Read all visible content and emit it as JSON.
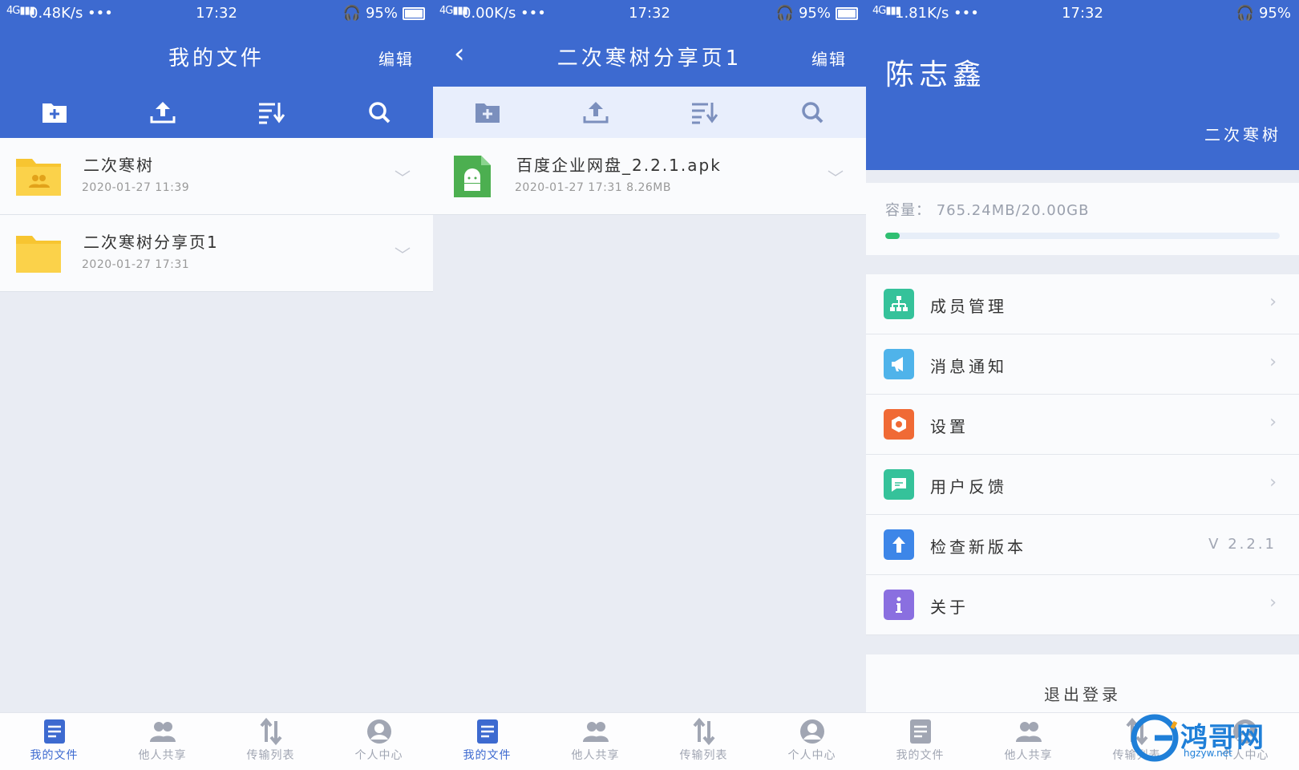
{
  "colors": {
    "primary": "#3d6ad0",
    "folder": "#f7c531",
    "apk": "#4caf50",
    "progress": "#2fbf71"
  },
  "panels": [
    {
      "status": {
        "net": "0.48K/s •••",
        "time": "17:32",
        "battery": "95%"
      },
      "title": "我的文件",
      "edit": "编辑",
      "files": [
        {
          "name": "二次寒树",
          "meta": "2020-01-27   11:39",
          "icon": "shared-folder-icon"
        },
        {
          "name": "二次寒树分享页1",
          "meta": "2020-01-27   17:31",
          "icon": "folder-icon"
        }
      ]
    },
    {
      "status": {
        "net": "0.00K/s •••",
        "time": "17:32",
        "battery": "95%"
      },
      "title": "二次寒树分享页1",
      "edit": "编辑",
      "files": [
        {
          "name": "百度企业网盘_2.2.1.apk",
          "meta": "2020-01-27   17:31   8.26MB",
          "icon": "android-apk-icon"
        }
      ]
    },
    {
      "status": {
        "net": "1.81K/s •••",
        "time": "17:32",
        "battery": "95%"
      },
      "profile": {
        "name": "陈志鑫",
        "team": "二次寒树"
      },
      "capacity": {
        "label": "容量：  765.24MB/20.00GB",
        "used_fraction": 0.037
      },
      "menu": [
        {
          "label": "成员管理",
          "icon": "org-chart-icon",
          "color": "#35c29a"
        },
        {
          "label": "消息通知",
          "icon": "megaphone-icon",
          "color": "#4fb3ea"
        },
        {
          "label": "设置",
          "icon": "hexagon-settings-icon",
          "color": "#f06a35"
        },
        {
          "label": "用户反馈",
          "icon": "chat-bubble-icon",
          "color": "#35c29a"
        },
        {
          "label": "检查新版本",
          "icon": "arrow-up-icon",
          "color": "#3d86e8",
          "value": "V 2.2.1"
        },
        {
          "label": "关于",
          "icon": "info-icon",
          "color": "#8a6fe0"
        }
      ],
      "logout": "退出登录"
    }
  ],
  "nav": [
    "我的文件",
    "他人共享",
    "传输列表",
    "个人中心"
  ],
  "watermark": {
    "text": "鸿哥网",
    "url": "hgzyw.net"
  }
}
